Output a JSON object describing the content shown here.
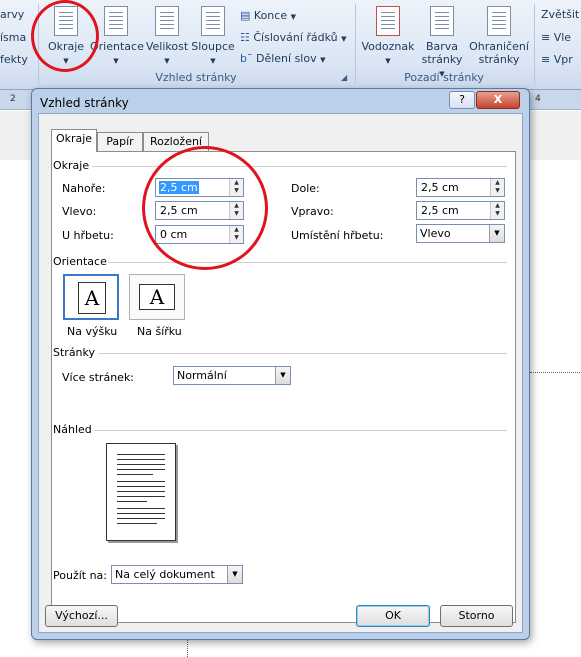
{
  "ribbon": {
    "left_items": [
      "arvy",
      "ísma",
      "fekty"
    ],
    "buttons": {
      "margins": "Okraje",
      "orientation": "Orientace",
      "size": "Velikost",
      "columns": "Sloupce"
    },
    "small_buttons": [
      "Konce",
      "Číslování řádků",
      "Dělení slov"
    ],
    "group_page_setup": "Vzhled stránky",
    "background_buttons": {
      "watermark": "Vodoznak",
      "page_color_1": "Barva",
      "page_color_2": "stránky",
      "borders_1": "Ohraničení",
      "borders_2": "stránky"
    },
    "group_background": "Pozadí stránky",
    "right_items": [
      "Zvětšit",
      "Vle",
      "Vpr"
    ],
    "ruler_marks": [
      "2",
      "4"
    ]
  },
  "dialog": {
    "title": "Vzhled stránky",
    "help": "?",
    "close": "X",
    "tabs": [
      "Okraje",
      "Papír",
      "Rozložení"
    ],
    "margins_section": "Okraje",
    "fields": {
      "top_label": "Nahoře:",
      "top_value": "2,5 cm",
      "left_label": "Vlevo:",
      "left_value": "2,5 cm",
      "gutter_label": "U hřbetu:",
      "gutter_value": "0 cm",
      "bottom_label": "Dole:",
      "bottom_value": "2,5 cm",
      "right_label": "Vpravo:",
      "right_value": "2,5 cm",
      "gutter_pos_label": "Umístění hřbetu:",
      "gutter_pos_value": "Vlevo"
    },
    "orientation_section": "Orientace",
    "portrait": "Na výšku",
    "landscape": "Na šířku",
    "orientation_glyph": "A",
    "pages_section": "Stránky",
    "multiple_pages_label": "Více stránek:",
    "multiple_pages_value": "Normální",
    "preview_section": "Náhled",
    "apply_to_label": "Použít na:",
    "apply_to_value": "Na celý dokument",
    "default_button": "Výchozí...",
    "ok_button": "OK",
    "cancel_button": "Storno"
  },
  "colors": {
    "annotation_red": "#e0141e",
    "selection_blue": "#3399ff"
  }
}
